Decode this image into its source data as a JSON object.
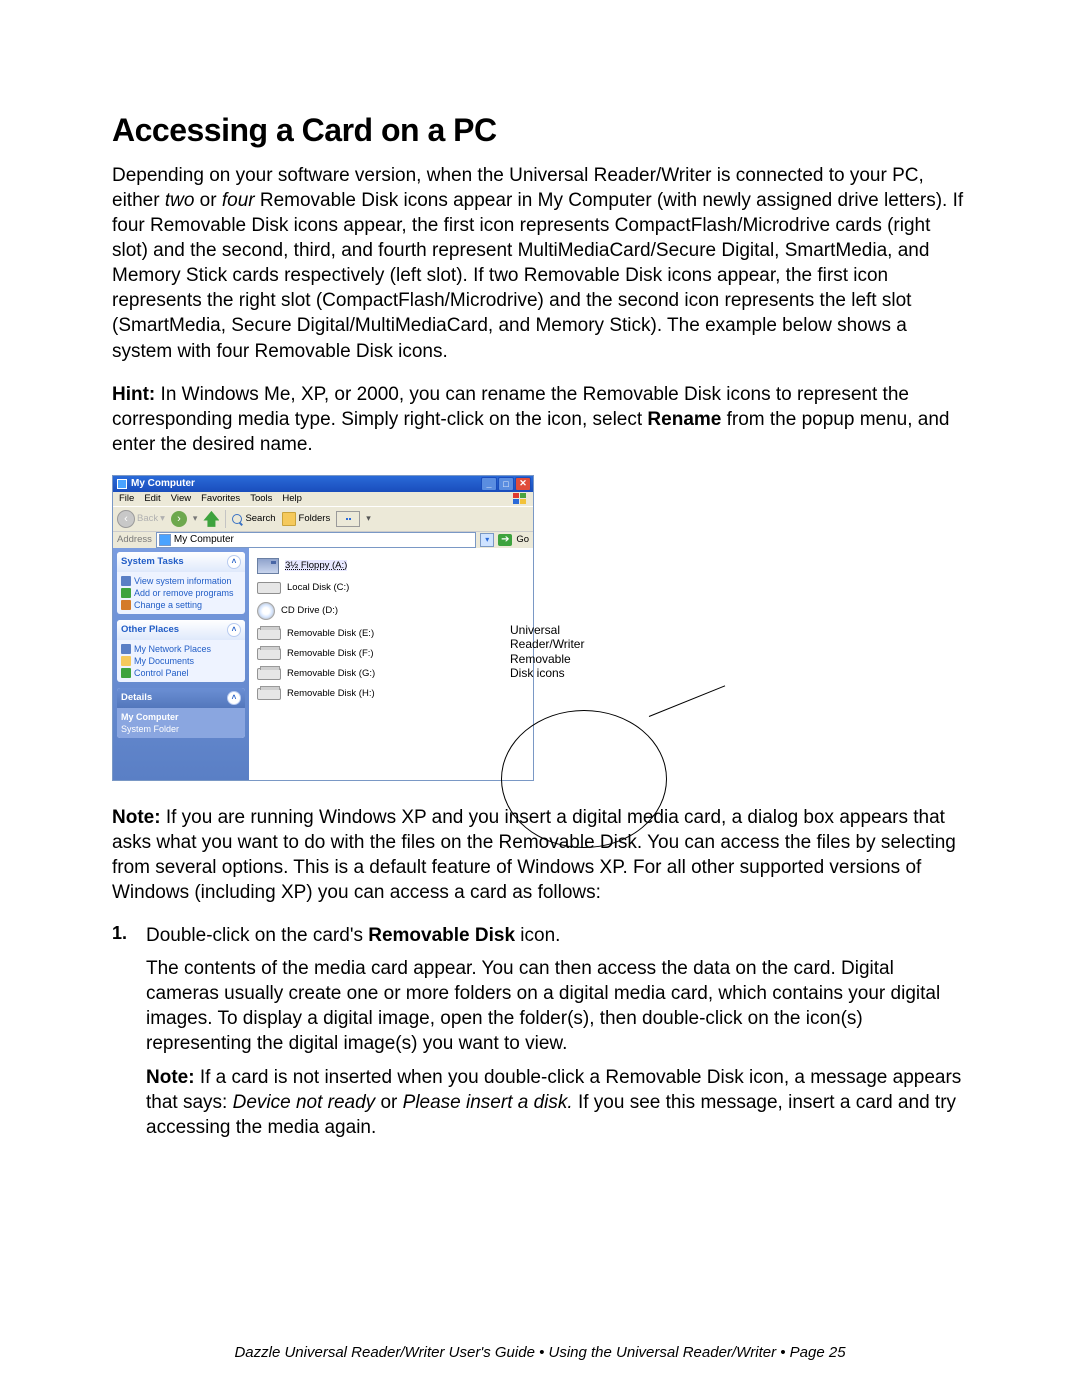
{
  "title": "Accessing a Card on a PC",
  "p1_a": "Depending on your software version, when the Universal Reader/Writer is connected to your PC, either ",
  "p1_two": "two",
  "p1_or": " or ",
  "p1_four": "four",
  "p1_b": " Removable Disk icons appear in My Computer (with newly assigned drive letters). If four Removable Disk icons appear, the first icon represents CompactFlash/Microdrive cards (right slot) and the second, third, and fourth represent MultiMediaCard/Secure Digital, SmartMedia, and Memory Stick cards respectively (left slot). If two Removable Disk icons appear, the first icon represents the right slot (CompactFlash/Microdrive) and the second icon represents the left slot (SmartMedia, Secure Digital/MultiMediaCard, and Memory Stick). The example below shows a system with four Removable Disk icons.",
  "hint_label": "Hint:",
  "hint_a": " In Windows Me, XP, or 2000, you can rename the Removable Disk icons to represent the corresponding media type. Simply right-click on the icon, select ",
  "hint_rename": "Rename",
  "hint_b": " from the popup menu, and enter the desired name.",
  "shot": {
    "window_title": "My Computer",
    "menu": {
      "file": "File",
      "edit": "Edit",
      "view": "View",
      "fav": "Favorites",
      "tools": "Tools",
      "help": "Help"
    },
    "toolbar": {
      "back": "Back",
      "search": "Search",
      "folders": "Folders"
    },
    "address_label": "Address",
    "address_value": "My Computer",
    "go": "Go",
    "side": {
      "tasks_title": "System Tasks",
      "tasks": [
        "View system information",
        "Add or remove programs",
        "Change a setting"
      ],
      "other_title": "Other Places",
      "other": [
        "My Network Places",
        "My Documents",
        "Control Panel"
      ],
      "details_title": "Details",
      "details_name": "My Computer",
      "details_type": "System Folder"
    },
    "drives": {
      "floppy": "3½ Floppy (A:)",
      "local": "Local Disk (C:)",
      "cd": "CD Drive (D:)",
      "e": "Removable Disk (E:)",
      "f": "Removable Disk (F:)",
      "g": "Removable Disk (G:)",
      "h": "Removable Disk (H:)"
    },
    "annotation": "Universal Reader/Writer Removable Disk icons"
  },
  "note_label": "Note:",
  "note_body": " If you are running Windows XP and you insert a digital media card, a dialog box appears that asks what you want to do with the files on the Removable Disk. You can access the files by selecting from several options. This is a default feature of Windows XP. For all other supported versions of Windows (including XP) you can access a card as follows:",
  "step1_num": "1.",
  "step1_a": "Double-click on the card's ",
  "step1_rd": "Removable Disk",
  "step1_b": " icon.",
  "step1_p2": "The contents of the media card appear. You can then access the data on the card. Digital cameras usually create one or more folders on a digital media card, which contains your digital images. To display a digital image, open the folder(s), then double-click on the icon(s) representing the digital image(s) you want to view.",
  "step1_note_a": " If a card is not inserted when you double-click a Removable Disk icon, a message appears that says: ",
  "step1_note_i1": "Device not ready",
  "step1_note_or": " or ",
  "step1_note_i2": "Please insert a disk.",
  "step1_note_b": " If you see this message, insert a card and try accessing the media again.",
  "footer": "Dazzle  Universal Reader/Writer User's Guide • Using the Universal Reader/Writer • Page 25"
}
